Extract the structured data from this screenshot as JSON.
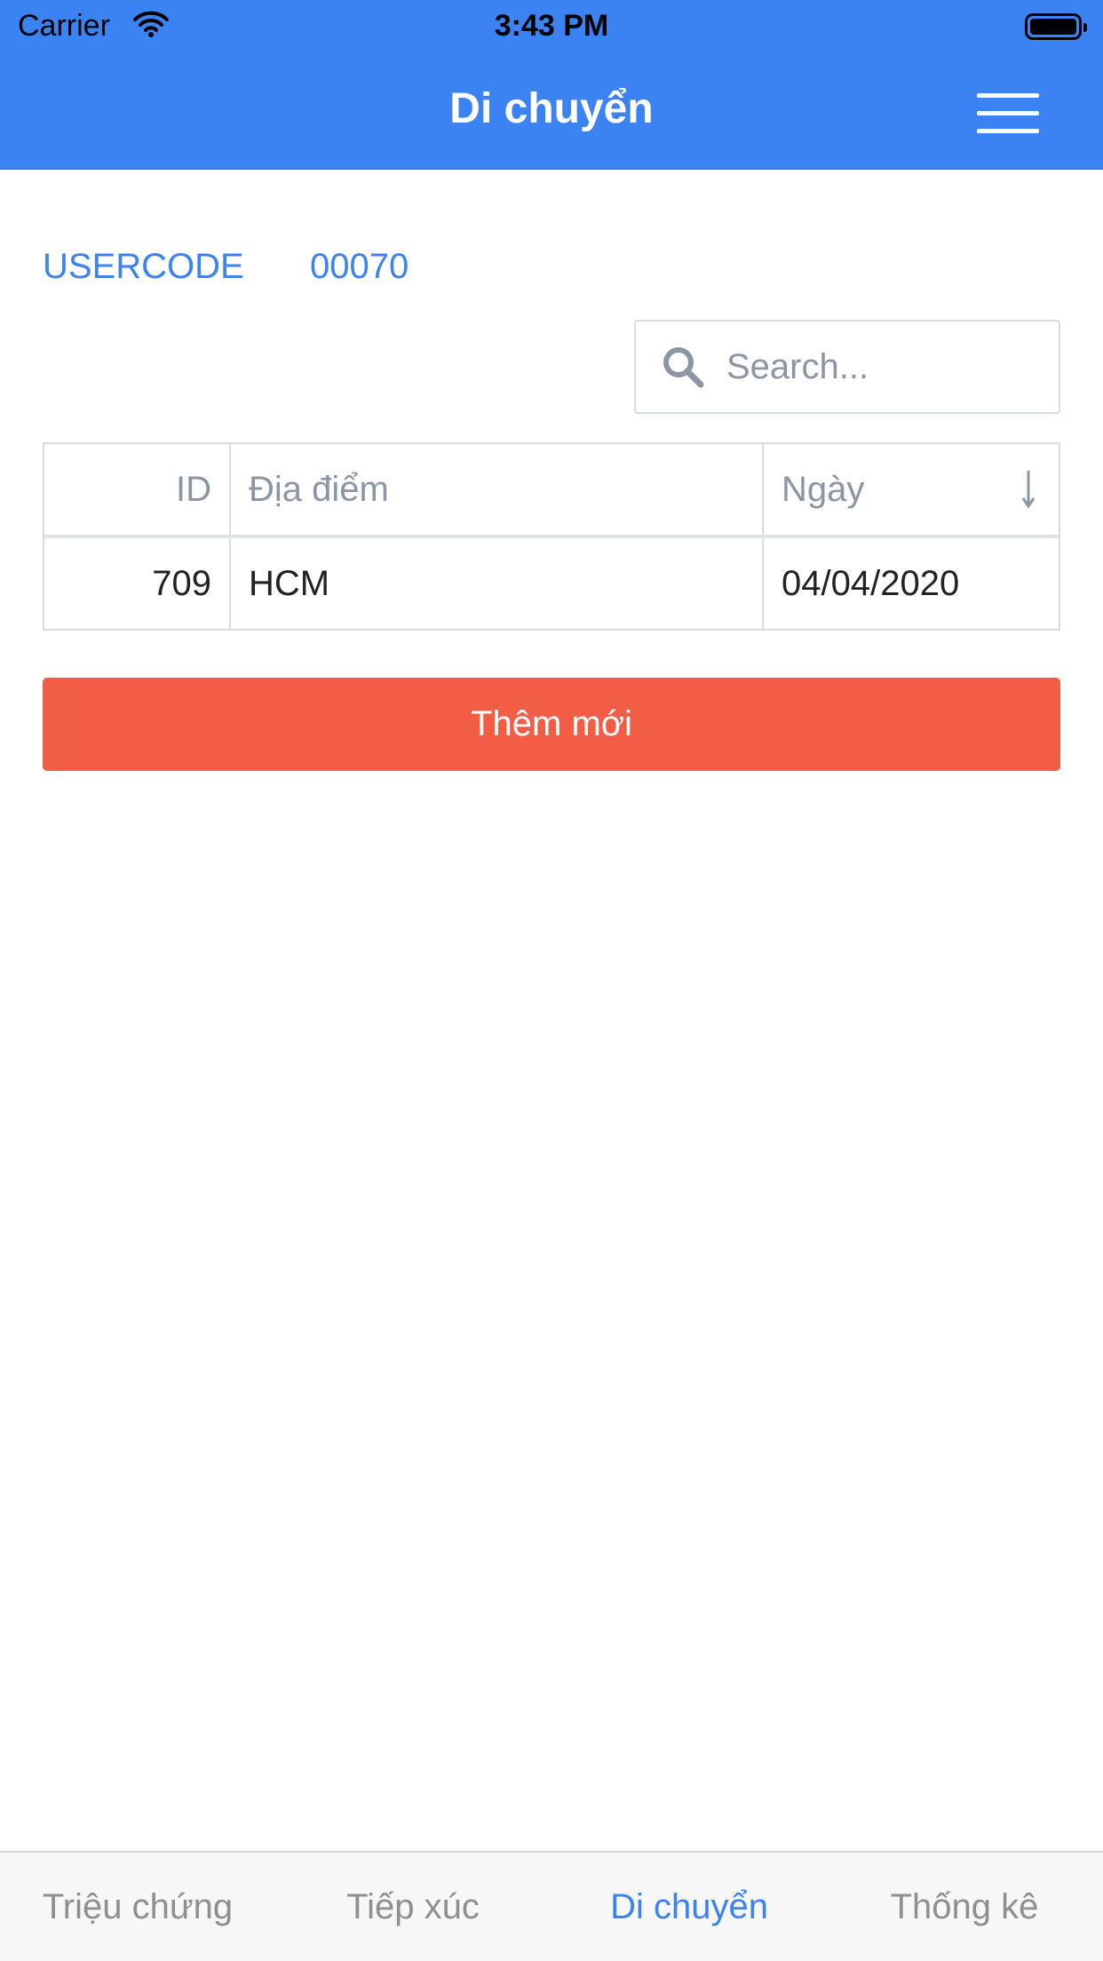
{
  "status_bar": {
    "carrier": "Carrier",
    "time": "3:43 PM"
  },
  "header": {
    "title": "Di chuyển",
    "menu_icon": "hamburger-menu-icon"
  },
  "user": {
    "label": "USERCODE",
    "code": "00070"
  },
  "search": {
    "placeholder": "Search...",
    "value": "",
    "icon": "search-icon"
  },
  "table": {
    "columns": [
      "ID",
      "Địa điểm",
      "Ngày"
    ],
    "sort_icon": "sort-descending-arrow-icon",
    "rows": [
      {
        "id": "709",
        "place": "HCM",
        "date": "04/04/2020"
      }
    ]
  },
  "actions": {
    "add_label": "Thêm mới"
  },
  "tabs": [
    {
      "label": "Triệu chứng",
      "active": false
    },
    {
      "label": "Tiếp xúc",
      "active": false
    },
    {
      "label": "Di chuyển",
      "active": true
    },
    {
      "label": "Thống kê",
      "active": false
    }
  ],
  "colors": {
    "primary": "#3b82f3",
    "danger": "#f15d45",
    "muted": "#8a96a3"
  }
}
